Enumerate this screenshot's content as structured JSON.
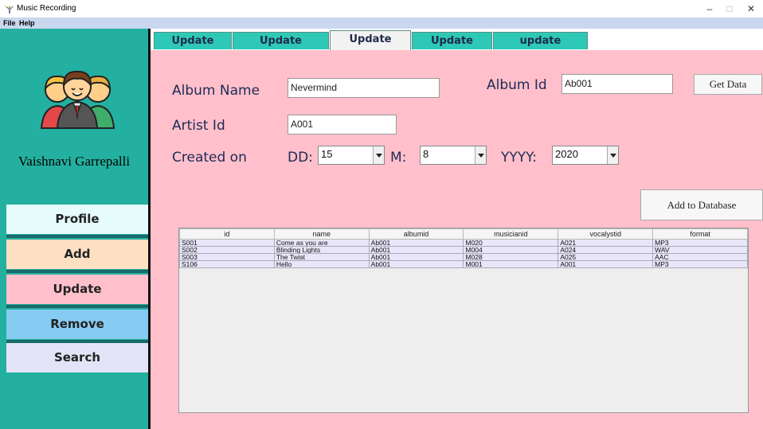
{
  "window": {
    "title": "Music Recording",
    "minimize": "–",
    "maximize": "□",
    "close": "✕"
  },
  "menu": {
    "file": "File",
    "help": "Help"
  },
  "sidebar": {
    "user_name": "Vaishnavi Garrepalli",
    "items": [
      {
        "label": "Profile",
        "color": "#e6fbfb"
      },
      {
        "label": "Add",
        "color": "#fde0c2"
      },
      {
        "label": "Update",
        "color": "#ffc0cb"
      },
      {
        "label": "Remove",
        "color": "#86ccf2"
      },
      {
        "label": "Search",
        "color": "#e4e4f8"
      }
    ]
  },
  "tabs": [
    {
      "label": "Update  Artist",
      "active": false
    },
    {
      "label": "Update Musicaian",
      "active": false
    },
    {
      "label": "Update Album",
      "active": true
    },
    {
      "label": "Update Songs",
      "active": false
    },
    {
      "label": "update Employee",
      "active": false
    }
  ],
  "form": {
    "album_name_label": "Album Name",
    "album_name_value": "Nevermind",
    "album_id_label": "Album Id",
    "album_id_value": "Ab001",
    "get_data_label": "Get Data",
    "artist_id_label": "Artist Id",
    "artist_id_value": "A001",
    "created_on_label": "Created on",
    "dd_label": "DD:",
    "dd_value": "15",
    "m_label": "M:",
    "m_value": "8",
    "yyyy_label": "YYYY:",
    "yyyy_value": "2020",
    "add_db_label": "Add to Database"
  },
  "table": {
    "columns": [
      "id",
      "name",
      "albumid",
      "musicianid",
      "vocalystid",
      "format"
    ],
    "rows": [
      [
        "S001",
        "Come as you are",
        "Ab001",
        "M020",
        "A021",
        "MP3"
      ],
      [
        "S002",
        "Blinding Lights",
        "Ab001",
        "M004",
        "A024",
        "WAV"
      ],
      [
        "S003",
        "The Twist",
        "Ab001",
        "M028",
        "A025",
        "AAC"
      ],
      [
        "S106",
        "Hello",
        "Ab001",
        "M001",
        "A001",
        "MP3"
      ]
    ]
  },
  "colors": {
    "sidebar": "#24b0a0",
    "content": "#ffc0cb",
    "tab_inactive": "#2ec9b6",
    "menubar": "#c9d7ef"
  }
}
